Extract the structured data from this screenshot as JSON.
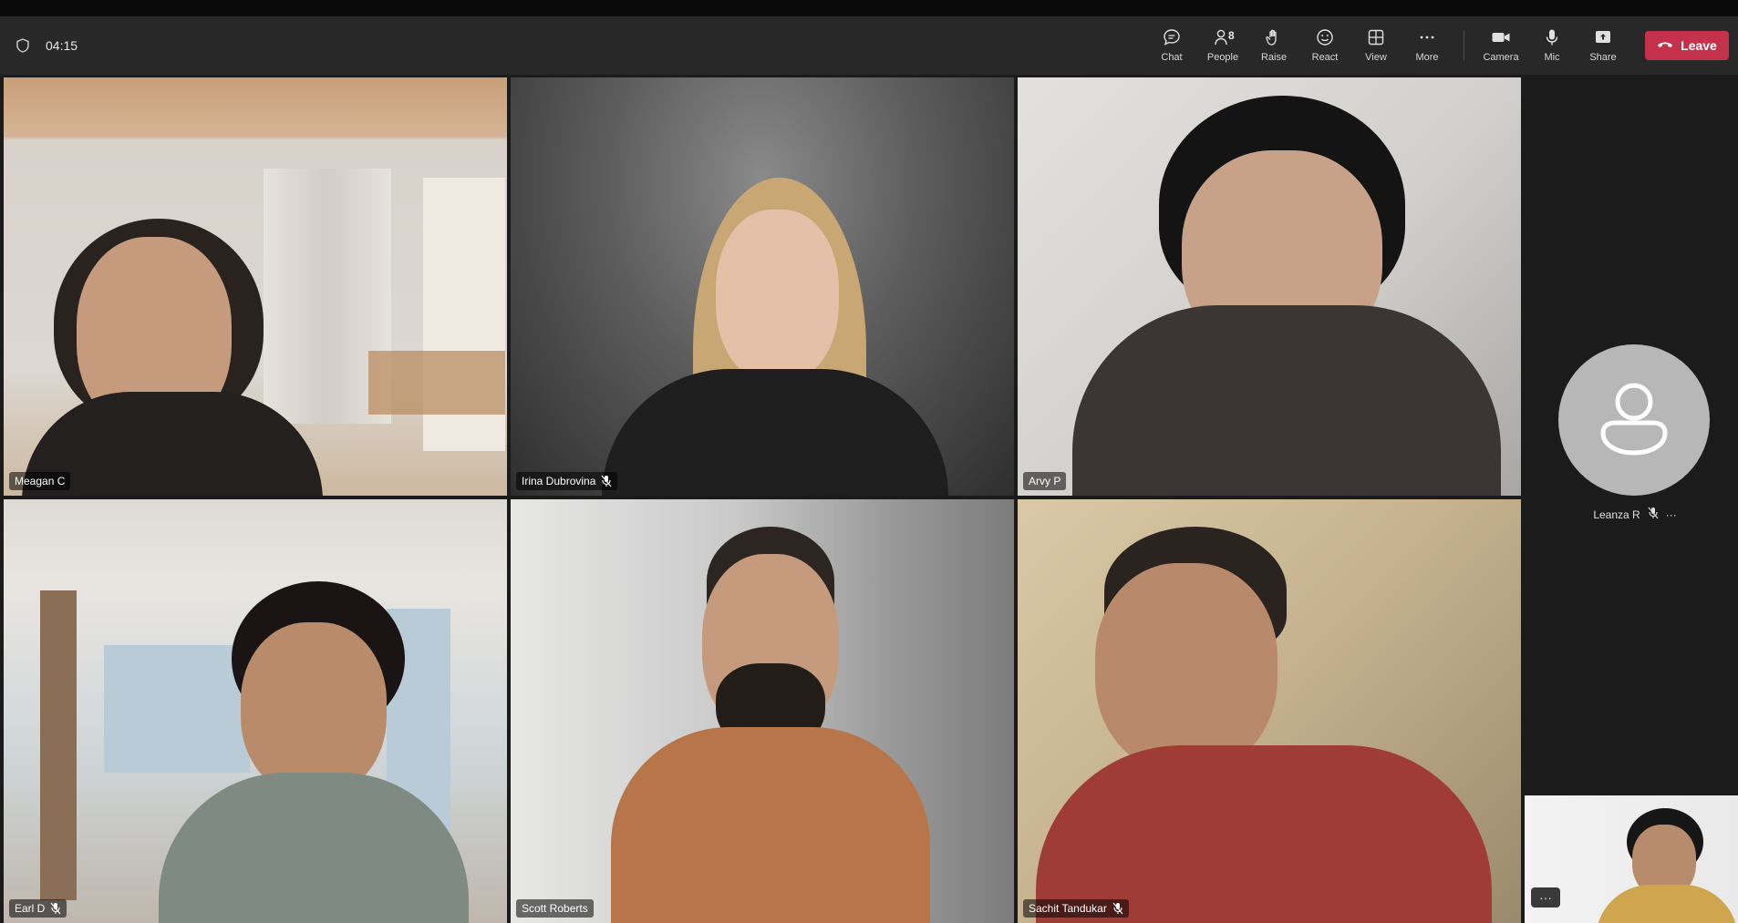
{
  "call": {
    "timer": "04:15"
  },
  "toolbar": {
    "chat": {
      "label": "Chat",
      "icon": "chat-icon"
    },
    "people": {
      "label": "People",
      "icon": "people-icon",
      "count": "8"
    },
    "raise": {
      "label": "Raise",
      "icon": "hand-icon"
    },
    "react": {
      "label": "React",
      "icon": "smiley-icon"
    },
    "view": {
      "label": "View",
      "icon": "grid-icon"
    },
    "more": {
      "label": "More",
      "icon": "ellipsis-icon"
    },
    "camera": {
      "label": "Camera",
      "icon": "camera-icon"
    },
    "mic": {
      "label": "Mic",
      "icon": "mic-icon"
    },
    "share": {
      "label": "Share",
      "icon": "share-icon"
    },
    "leave": {
      "label": "Leave",
      "icon": "phone-hangup-icon",
      "color": "#c4314b"
    }
  },
  "participants": [
    {
      "name": "Meagan C",
      "muted": false,
      "active_speaker": true
    },
    {
      "name": "Irina Dubrovina",
      "muted": true
    },
    {
      "name": "Arvy P",
      "muted": false
    },
    {
      "name": "Earl D",
      "muted": true
    },
    {
      "name": "Scott Roberts",
      "muted": false
    },
    {
      "name": "Sachit Tandukar",
      "muted": true
    }
  ],
  "sidebar_participant": {
    "name": "Leanza R",
    "muted": true,
    "more": "···"
  },
  "self_view": {
    "more": "···"
  },
  "colors": {
    "accent": "#6264a7",
    "toolbar_bg": "#282828",
    "stage_bg": "#1b1b1b"
  }
}
